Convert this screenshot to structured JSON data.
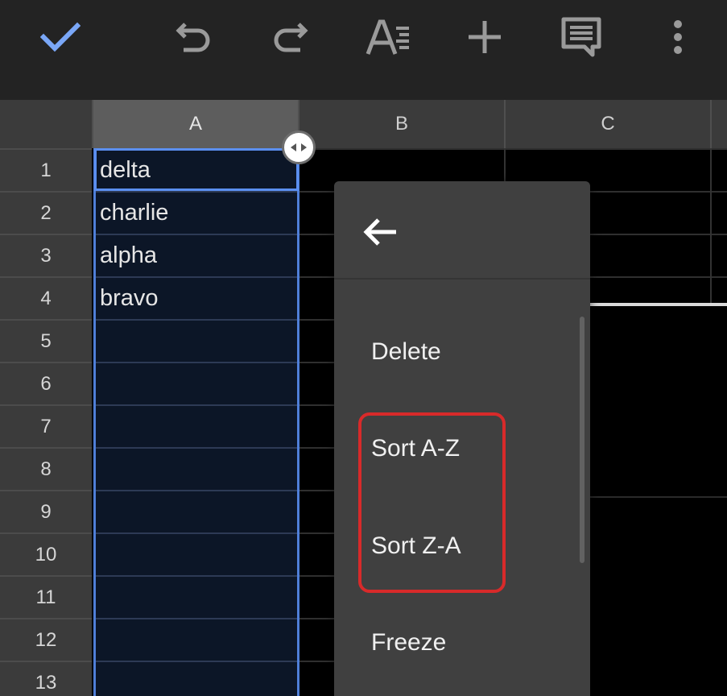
{
  "toolbar": {
    "icons": [
      "check-icon",
      "undo-icon",
      "redo-icon",
      "text-format-icon",
      "insert-plus-icon",
      "comment-icon",
      "more-vert-icon"
    ],
    "accent": "#7aa7f7"
  },
  "grid": {
    "columns": [
      "A",
      "B",
      "C"
    ],
    "selected_column": "A",
    "rows": [
      "1",
      "2",
      "3",
      "4",
      "5",
      "6",
      "7",
      "8",
      "9",
      "10",
      "11",
      "12",
      "13"
    ],
    "column_a_values": [
      "delta",
      "charlie",
      "alpha",
      "bravo",
      "",
      "",
      "",
      "",
      "",
      "",
      "",
      "",
      ""
    ]
  },
  "menu": {
    "back_icon": "arrow-left-icon",
    "items": [
      "Delete",
      "Sort A-Z",
      "Sort Z-A",
      "Freeze"
    ]
  },
  "colors": {
    "selection": "#4f7fd8",
    "highlight": "#d82a2a"
  }
}
